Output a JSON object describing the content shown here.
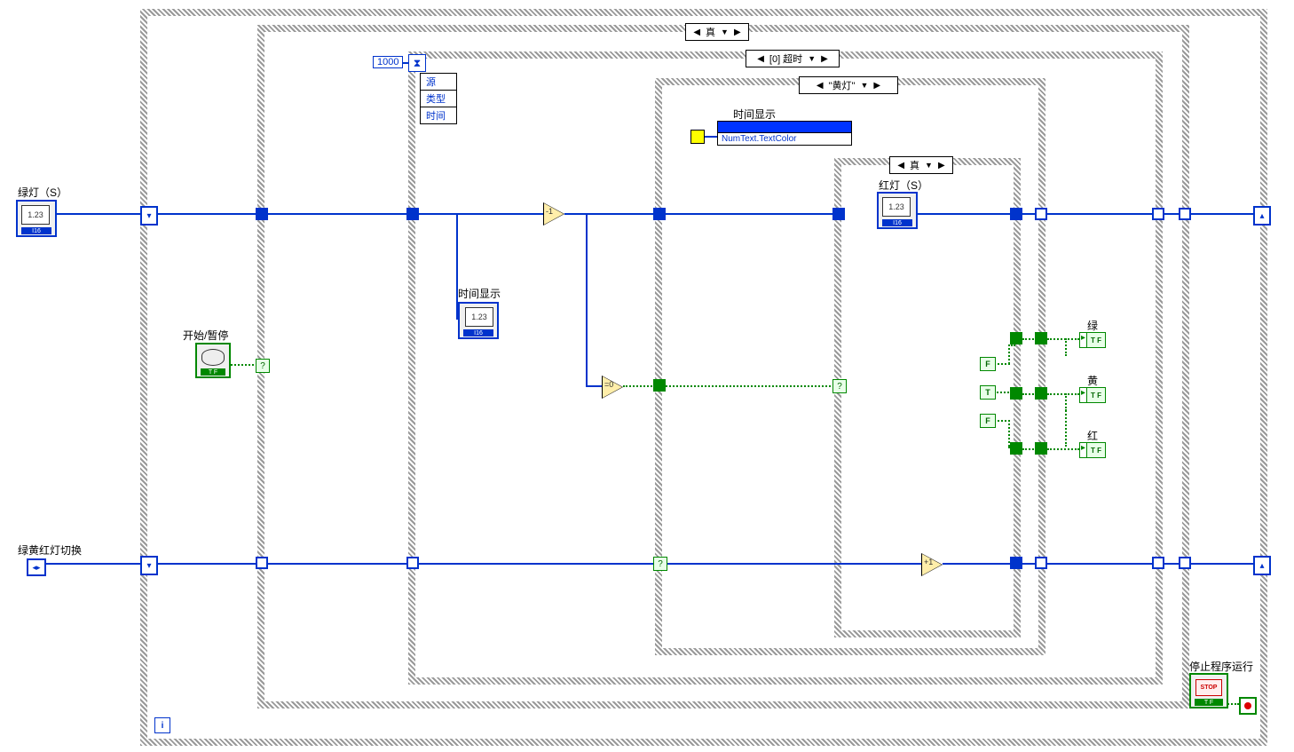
{
  "labels": {
    "green_s": "绿灯（S）",
    "switch": "绿黄红灯切换",
    "start_pause": "开始/暂停",
    "time_disp_ind": "时间显示",
    "time_disp_prop": "时间显示",
    "red_s": "红灯（S）",
    "green": "绿",
    "yellow": "黄",
    "red": "红",
    "stop_run": "停止程序运行"
  },
  "const": {
    "ms": "1000",
    "i": "i"
  },
  "selectors": {
    "outer_case": "真",
    "event_case": "[0] 超时",
    "string_case": "\"黄灯\"",
    "inner_case": "真"
  },
  "cfg": {
    "r1": "源",
    "r2": "类型",
    "r3": "时间"
  },
  "prop": {
    "title": " ",
    "row": "NumText.TextColor"
  },
  "ops": {
    "dec": "-1",
    "eq0": "=0",
    "inc": "+1"
  },
  "ctrl_num": "1.23",
  "ctrl_tag": "I16",
  "ctrl_tag2": "I16",
  "bool": {
    "F": "F",
    "T": "T",
    "TF": "T F"
  },
  "stop": "STOP"
}
